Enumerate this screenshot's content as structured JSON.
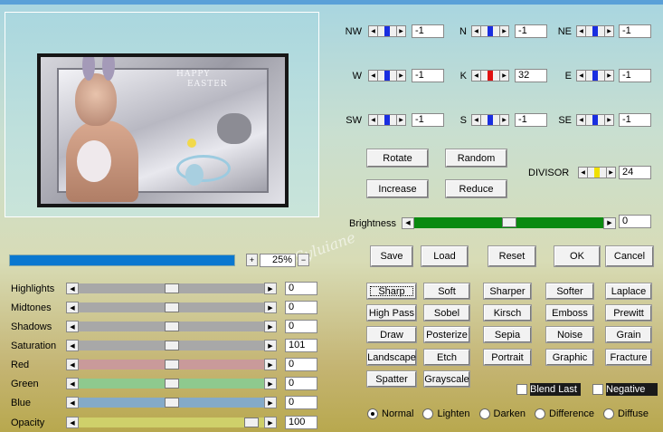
{
  "preview": {
    "title_line1": "HAPPY",
    "title_line2": "EASTER",
    "watermark": "Syluiane"
  },
  "zoom": {
    "plus": "+",
    "minus": "−",
    "value": "25%"
  },
  "sliders": [
    {
      "label": "Highlights",
      "value": "0",
      "color": "#a8a8a8",
      "level": 0.5
    },
    {
      "label": "Midtones",
      "value": "0",
      "color": "#a8a8a8",
      "level": 0.5
    },
    {
      "label": "Shadows",
      "value": "0",
      "color": "#a8a8a8",
      "level": 0.5
    },
    {
      "label": "Saturation",
      "value": "101",
      "color": "#a8a8a8",
      "level": 0.5
    },
    {
      "label": "Red",
      "value": "0",
      "color": "#c99a9a",
      "level": 0.5
    },
    {
      "label": "Green",
      "value": "0",
      "color": "#8ec98e",
      "level": 0.5
    },
    {
      "label": "Blue",
      "value": "0",
      "color": "#84aac8",
      "level": 0.5
    },
    {
      "label": "Opacity",
      "value": "100",
      "color": "#cfd06a",
      "level": 0.93
    }
  ],
  "directions": [
    {
      "label": "NW",
      "value": "-1",
      "color": "#1a2ee0"
    },
    {
      "label": "N",
      "value": "-1",
      "color": "#1a2ee0"
    },
    {
      "label": "NE",
      "value": "-1",
      "color": "#1a2ee0"
    },
    {
      "label": "W",
      "value": "-1",
      "color": "#1a2ee0"
    },
    {
      "label": "K",
      "value": "32",
      "color": "#e01010"
    },
    {
      "label": "E",
      "value": "-1",
      "color": "#1a2ee0"
    },
    {
      "label": "SW",
      "value": "-1",
      "color": "#1a2ee0"
    },
    {
      "label": "S",
      "value": "-1",
      "color": "#1a2ee0"
    },
    {
      "label": "SE",
      "value": "-1",
      "color": "#1a2ee0"
    }
  ],
  "buttons": {
    "rotate": "Rotate",
    "random": "Random",
    "increase": "Increase",
    "reduce": "Reduce",
    "save": "Save",
    "load": "Load",
    "reset": "Reset",
    "ok": "OK",
    "cancel": "Cancel"
  },
  "divisor": {
    "label": "DIVISOR",
    "value": "24",
    "color": "#f0e000"
  },
  "brightness": {
    "label": "Brightness",
    "value": "0",
    "color": "#0a8a10",
    "level": 0.5
  },
  "presets": [
    [
      "Sharp",
      "Soft",
      "Sharper",
      "Softer",
      "Laplace"
    ],
    [
      "High Pass",
      "Sobel",
      "Kirsch",
      "Emboss",
      "Prewitt"
    ],
    [
      "Draw",
      "Posterize",
      "Sepia",
      "Noise",
      "Grain"
    ],
    [
      "Landscape",
      "Etch",
      "Portrait",
      "Graphic",
      "Fracture"
    ],
    [
      "Spatter",
      "Grayscale"
    ]
  ],
  "checks": {
    "blend_last": "Blend Last",
    "negative": "Negative"
  },
  "modes": [
    "Normal",
    "Lighten",
    "Darken",
    "Difference",
    "Diffuse"
  ],
  "selected_mode": "Normal"
}
